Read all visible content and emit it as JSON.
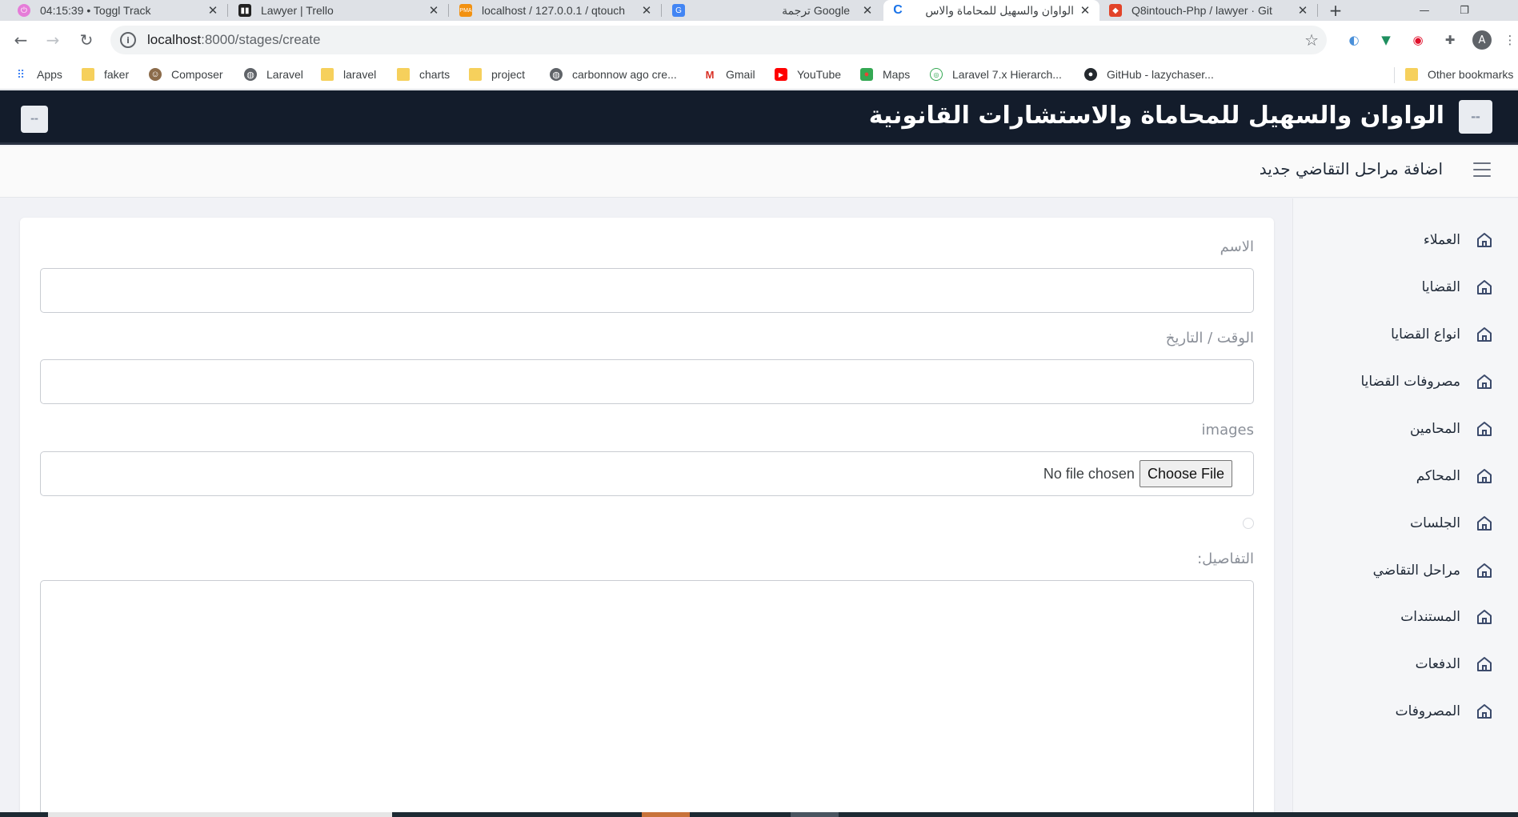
{
  "browser": {
    "tabs": [
      {
        "title": "04:15:39 • Toggl Track",
        "favicon": "toggl-icon",
        "color": "#e57cd8"
      },
      {
        "title": "Lawyer | Trello",
        "favicon": "trello-icon",
        "color": "#222222"
      },
      {
        "title": "localhost / 127.0.0.1 / qtouch",
        "favicon": "phpmyadmin-icon",
        "color": "#f29111"
      },
      {
        "title": "ترجمة Google",
        "favicon": "google-translate-icon",
        "color": "#4285f4"
      },
      {
        "title": "الواوان والسهيل للمحاماة والاس",
        "favicon": "app-icon",
        "color": "#1a73e8"
      },
      {
        "title": "Q8intouch-Php / lawyer · Git",
        "favicon": "gitlab-icon",
        "color": "#e24329"
      }
    ],
    "url_host": "localhost",
    "url_path": ":8000/stages/create",
    "profile_initial": "A"
  },
  "bookmarks": [
    {
      "label": "Apps",
      "icon": "apps-grid-icon"
    },
    {
      "label": "faker",
      "icon": "folder-icon"
    },
    {
      "label": "Composer",
      "icon": "composer-icon"
    },
    {
      "label": "Laravel",
      "icon": "globe-icon"
    },
    {
      "label": "laravel",
      "icon": "folder-icon"
    },
    {
      "label": "charts",
      "icon": "folder-icon"
    },
    {
      "label": "project",
      "icon": "folder-icon"
    },
    {
      "label": "carbonnow ago cre...",
      "icon": "globe-icon"
    },
    {
      "label": "Gmail",
      "icon": "gmail-icon"
    },
    {
      "label": "YouTube",
      "icon": "youtube-icon"
    },
    {
      "label": "Maps",
      "icon": "maps-icon"
    },
    {
      "label": "Laravel 7.x Hierarch...",
      "icon": "laravel-hierarchy-icon"
    },
    {
      "label": "GitHub - lazychaser...",
      "icon": "github-icon"
    },
    {
      "label": "Other bookmarks",
      "icon": "folder-icon"
    }
  ],
  "app": {
    "title": "الواوان والسهيل للمحاماة والاستشارات القانونية",
    "page_heading": "اضافة مراحل التقاضي جديد",
    "sidebar": [
      {
        "label": "العملاء"
      },
      {
        "label": "القضايا"
      },
      {
        "label": "انواع القضايا"
      },
      {
        "label": "مصروفات القضايا"
      },
      {
        "label": "المحامين"
      },
      {
        "label": "المحاكم"
      },
      {
        "label": "الجلسات"
      },
      {
        "label": "مراحل التقاضي"
      },
      {
        "label": "المستندات"
      },
      {
        "label": "الدفعات"
      },
      {
        "label": "المصروفات"
      }
    ],
    "form": {
      "name_label": "الاسم",
      "datetime_label": "الوقت / التاريخ",
      "images_label": "images",
      "file_button": "Choose File",
      "file_status": "No file chosen",
      "details_label": "التفاصيل:"
    }
  },
  "colors": {
    "header_bg": "#131c2b",
    "sidebar_icon": "#3b4a6b"
  }
}
